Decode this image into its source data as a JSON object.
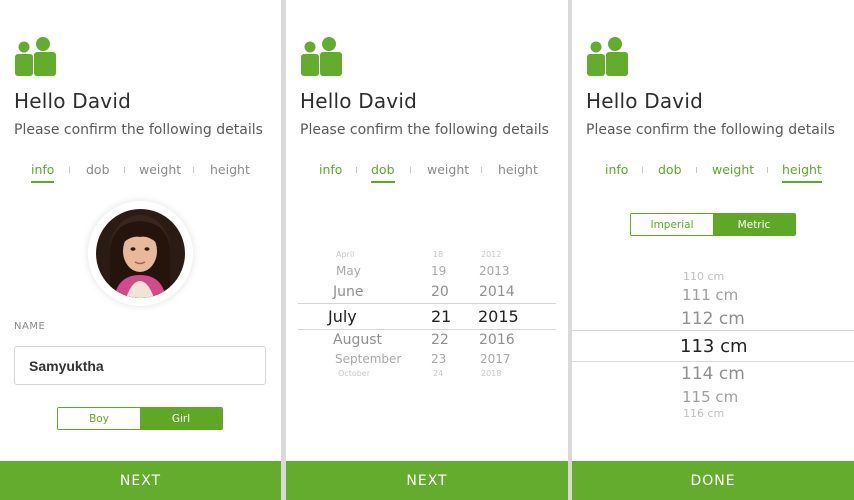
{
  "common": {
    "greeting": "Hello David",
    "subtitle": "Please confirm the following details",
    "tabs": [
      "info",
      "dob",
      "weight",
      "height"
    ],
    "brand_color": "#64ac2e",
    "logo_icon": "people-icon"
  },
  "screen1": {
    "active_tab": "info",
    "name_label": "NAME",
    "name_value": "Samyuktha",
    "gender": {
      "options": [
        "Boy",
        "Girl"
      ],
      "selected": "Girl"
    },
    "button": "NEXT"
  },
  "screen2": {
    "active_tab": "dob",
    "months": [
      "April",
      "May",
      "June",
      "July",
      "August",
      "September",
      "October"
    ],
    "days": [
      "18",
      "19",
      "20",
      "21",
      "22",
      "23",
      "24"
    ],
    "years": [
      "2012",
      "2013",
      "2014",
      "2015",
      "2016",
      "2017",
      "2018"
    ],
    "selected": {
      "month": "July",
      "day": "21",
      "year": "2015"
    },
    "button": "NEXT"
  },
  "screen3": {
    "active_tab": "height",
    "unit": {
      "options": [
        "Imperial",
        "Metric"
      ],
      "selected": "Metric"
    },
    "heights": [
      "110 cm",
      "111 cm",
      "112 cm",
      "113 cm",
      "114 cm",
      "115 cm",
      "116 cm"
    ],
    "selected": "113 cm",
    "button": "DONE"
  }
}
